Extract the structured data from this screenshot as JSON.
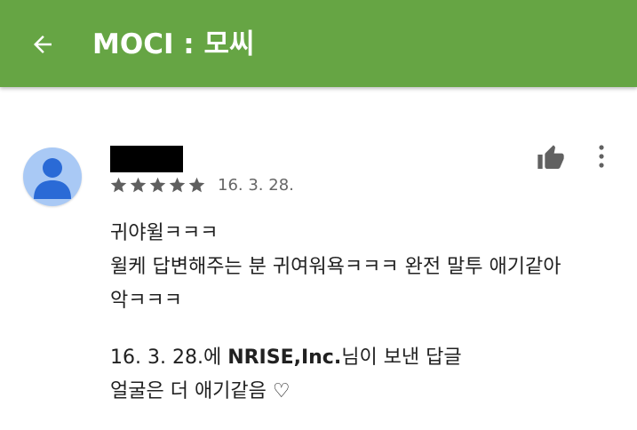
{
  "app_bar": {
    "title": "MOCI : 모씨",
    "back_icon": "arrow-back-icon",
    "background": "#66a544"
  },
  "review": {
    "rating": 5,
    "rating_max": 5,
    "date": "16. 3. 28.",
    "body_lines": [
      "귀야윌ㅋㅋㅋ",
      "윌케 답변해주는 분 귀여워욕ㅋㅋㅋ 완전 말투 애기같아",
      "악ㅋㅋㅋ"
    ],
    "reply": {
      "date": "16. 3. 28.",
      "prefix_suffix": "에 ",
      "developer": "NRISE,Inc.",
      "sent_label": "님이 보낸 답글",
      "text": "얼굴은 더 애기같음 ♡"
    }
  },
  "colors": {
    "star": "#5f5f5f",
    "icon": "#616161",
    "avatar_bg": "#a9c9f5",
    "avatar_fg": "#2a6ad6"
  }
}
